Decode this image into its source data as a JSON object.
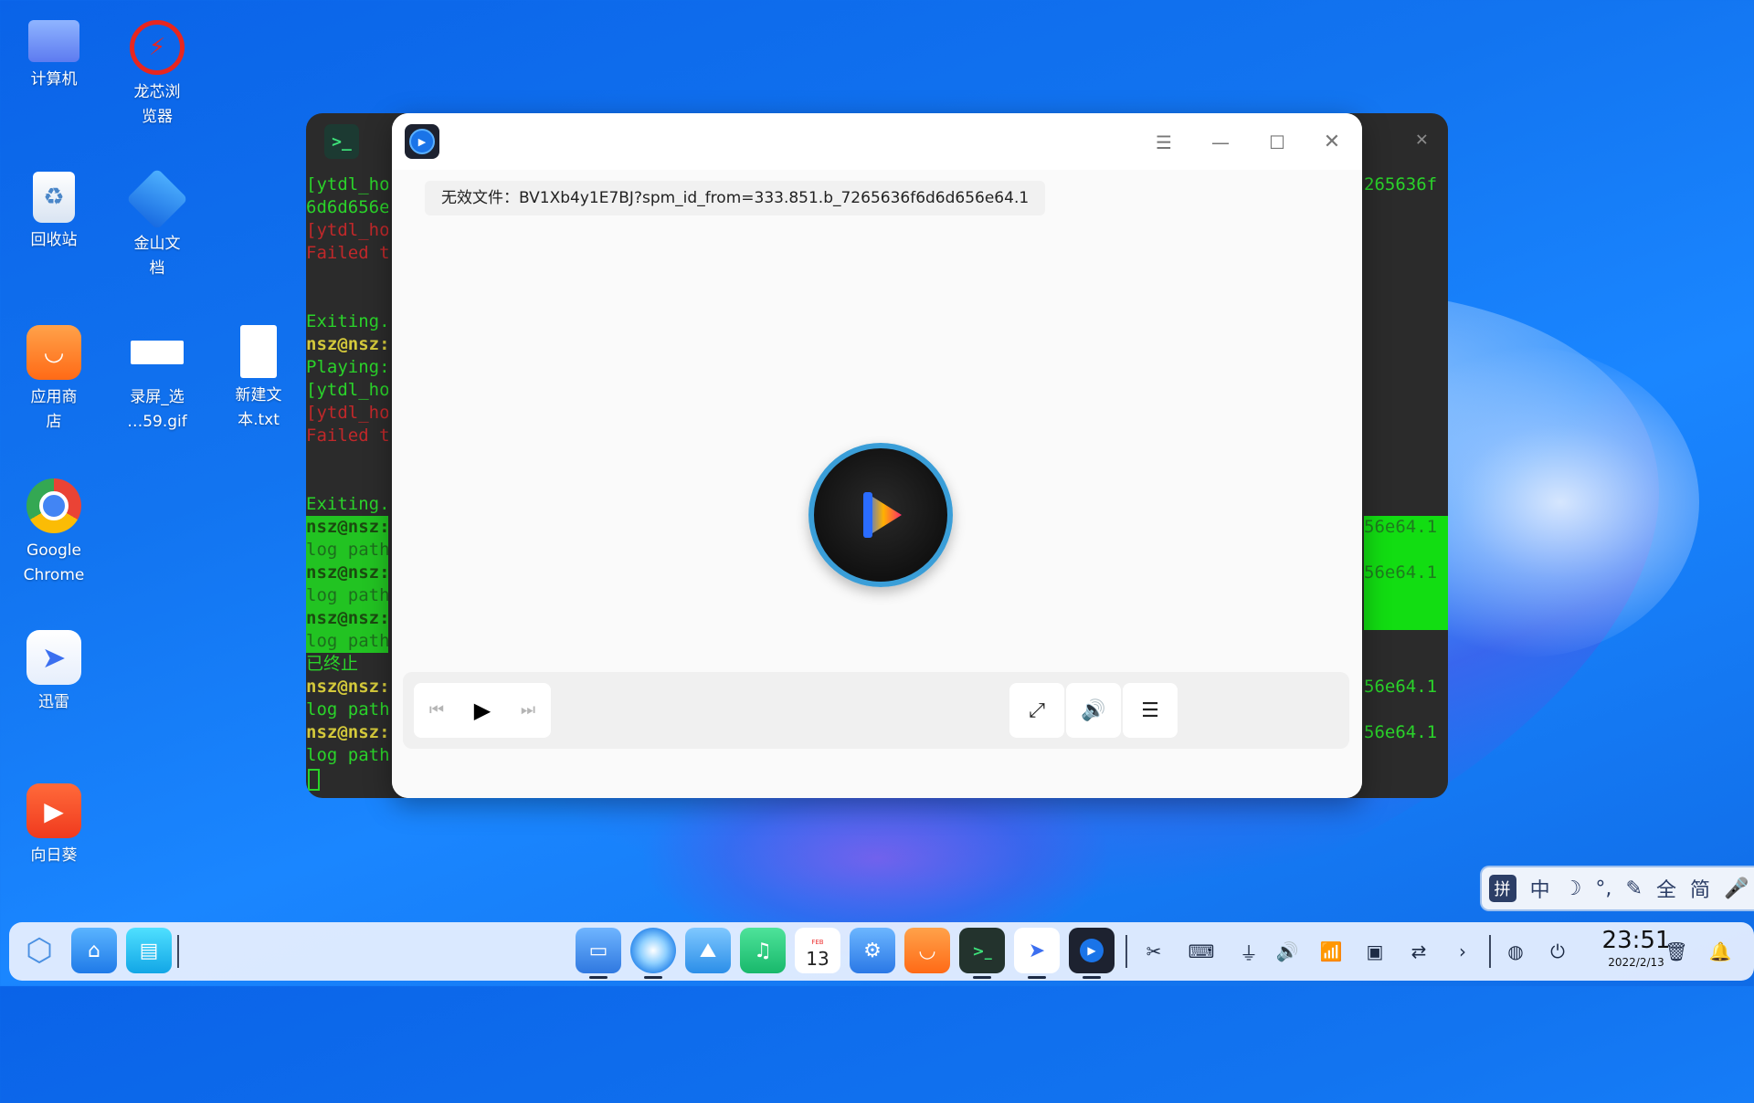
{
  "desktop": {
    "icons": [
      {
        "id": "computer",
        "label": "计算机",
        "icon": "monitor-icon"
      },
      {
        "id": "browser",
        "label": "龙芯浏\n览器",
        "icon": "loongson-browser-icon"
      },
      {
        "id": "trash",
        "label": "回收站",
        "icon": "trash-icon"
      },
      {
        "id": "wps",
        "label": "金山文\n档",
        "icon": "wps-docs-icon"
      },
      {
        "id": "appstore",
        "label": "应用商\n店",
        "icon": "app-store-icon"
      },
      {
        "id": "gif",
        "label": "录屏_选\n…59.gif",
        "icon": "gif-file-icon"
      },
      {
        "id": "txt",
        "label": "新建文\n本.txt",
        "icon": "text-file-icon"
      },
      {
        "id": "chrome",
        "label": "Google\nChrome",
        "icon": "chrome-icon"
      },
      {
        "id": "xunlei",
        "label": "迅雷",
        "icon": "xunlei-icon"
      },
      {
        "id": "sunlogin",
        "label": "向日葵",
        "icon": "sunlogin-icon"
      }
    ]
  },
  "terminal": {
    "title_icon": "terminal-icon",
    "left_lines": [
      {
        "text": "[ytdl_ho",
        "cls": "c-green"
      },
      {
        "text": "6d6d656e",
        "cls": "c-green"
      },
      {
        "text": "[ytdl_ho",
        "cls": "c-red"
      },
      {
        "text": "Failed t",
        "cls": "c-red"
      },
      {
        "text": "",
        "cls": ""
      },
      {
        "text": "",
        "cls": ""
      },
      {
        "text": "Exiting.",
        "cls": "c-green"
      },
      {
        "text": "nsz@nsz:",
        "cls": "c-user"
      },
      {
        "text": "Playing:",
        "cls": "c-green"
      },
      {
        "text": "[ytdl_ho",
        "cls": "c-green"
      },
      {
        "text": "[ytdl_ho",
        "cls": "c-red"
      },
      {
        "text": "Failed t",
        "cls": "c-red"
      },
      {
        "text": "",
        "cls": ""
      },
      {
        "text": "",
        "cls": ""
      },
      {
        "text": "Exiting.",
        "cls": "c-green"
      },
      {
        "text": "nsz@nsz:",
        "cls": "hl-user"
      },
      {
        "text": "log path",
        "cls": "hl"
      },
      {
        "text": "nsz@nsz:",
        "cls": "hl-user"
      },
      {
        "text": "log path",
        "cls": "hl"
      },
      {
        "text": "nsz@nsz:",
        "cls": "hl-user"
      },
      {
        "text": "log path",
        "cls": "hl"
      },
      {
        "text": "已终止",
        "cls": "c-green"
      },
      {
        "text": "nsz@nsz:",
        "cls": "c-user"
      },
      {
        "text": "log path",
        "cls": "c-green"
      },
      {
        "text": "nsz@nsz:",
        "cls": "c-user"
      },
      {
        "text": "log path",
        "cls": "c-green"
      }
    ],
    "right_lines": [
      {
        "text": "265636f",
        "cls": "c-green"
      },
      {
        "text": "",
        "cls": ""
      },
      {
        "text": "",
        "cls": ""
      },
      {
        "text": "",
        "cls": ""
      },
      {
        "text": "",
        "cls": ""
      },
      {
        "text": "",
        "cls": ""
      },
      {
        "text": "",
        "cls": ""
      },
      {
        "text": "",
        "cls": ""
      },
      {
        "text": "",
        "cls": ""
      },
      {
        "text": "",
        "cls": ""
      },
      {
        "text": "",
        "cls": ""
      },
      {
        "text": "",
        "cls": ""
      },
      {
        "text": "",
        "cls": ""
      },
      {
        "text": "",
        "cls": ""
      },
      {
        "text": "",
        "cls": ""
      },
      {
        "text": "56e64.1",
        "cls": "hl-right"
      },
      {
        "text": "",
        "cls": "hl-right"
      },
      {
        "text": "56e64.1",
        "cls": "hl-right"
      },
      {
        "text": "",
        "cls": "hl-right"
      },
      {
        "text": "",
        "cls": "hl-right"
      },
      {
        "text": "",
        "cls": ""
      },
      {
        "text": "",
        "cls": ""
      },
      {
        "text": "56e64.1",
        "cls": "c-green"
      },
      {
        "text": "",
        "cls": ""
      },
      {
        "text": "56e64.1",
        "cls": "c-green"
      },
      {
        "text": "",
        "cls": ""
      }
    ]
  },
  "player": {
    "logo_icon": "movie-player-icon",
    "menu_icon": "menu-icon",
    "minimize_icon": "minimize-icon",
    "maximize_icon": "maximize-icon",
    "close_icon": "close-icon",
    "error_message": "无效文件：BV1Xb4y1E7BJ?spm_id_from=333.851.b_7265636f6d6d656e64.1",
    "controls": {
      "prev_icon": "previous-icon",
      "play_icon": "play-icon",
      "next_icon": "next-icon",
      "fullscreen_icon": "fullscreen-icon",
      "volume_icon": "volume-icon",
      "playlist_icon": "playlist-icon"
    }
  },
  "ime_bar": {
    "items": [
      "拼",
      "中",
      "☽",
      "°,",
      "✎",
      "全",
      "简",
      "🎤"
    ]
  },
  "dock": {
    "left_apps": [
      "launcher-icon",
      "home-folder-icon",
      "multitask-icon"
    ],
    "apps": [
      "file-manager-icon",
      "browser-icon",
      "image-viewer-icon",
      "music-icon",
      "calendar-icon",
      "settings-icon",
      "app-store-icon",
      "terminal-icon",
      "xunlei-icon",
      "movie-player-icon"
    ],
    "calendar_day": "13",
    "calendar_month": "FEB",
    "tray": [
      "screenshot-icon",
      "keyboard-icon",
      "usb-icon",
      "volume-icon",
      "wifi-icon",
      "display-icon",
      "switch-icon",
      "expand-tray-icon"
    ],
    "system": [
      "network-status-icon",
      "power-icon"
    ],
    "clock": {
      "time": "23:51",
      "date": "2022/2/13"
    },
    "right": [
      "trash-icon",
      "notification-icon"
    ]
  },
  "colors": {
    "terminal_bg": "#2b2b2b",
    "terminal_green": "#2ad32a",
    "terminal_red": "#c0282a",
    "player_ring": "#3a9ed8",
    "wallpaper": "#1274f0"
  }
}
